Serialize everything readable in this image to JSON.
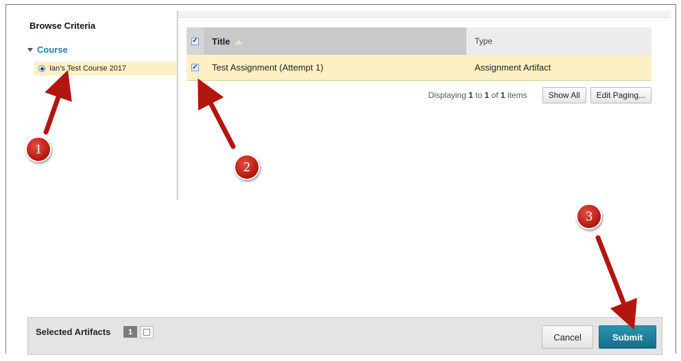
{
  "browse": {
    "title": "Browse Criteria",
    "course_label": "Course",
    "selected_course": "Ian's Test Course 2017"
  },
  "table": {
    "title_header": "Title",
    "type_header": "Type",
    "rows": [
      {
        "title": "Test Assignment (Attempt 1)",
        "type": "Assignment Artifact",
        "checked": true
      }
    ]
  },
  "paging": {
    "prefix": "Displaying",
    "from": "1",
    "to_word": "to",
    "to": "1",
    "of_word": "of",
    "total": "1",
    "suffix": "items",
    "show_all_label": "Show All",
    "edit_paging_label": "Edit Paging..."
  },
  "footer": {
    "selected_label": "Selected Artifacts",
    "selected_count": "1",
    "cancel_label": "Cancel",
    "submit_label": "Submit"
  },
  "annotations": {
    "step1": "1",
    "step2": "2",
    "step3": "3",
    "arrow_color": "#b3150f"
  },
  "colors": {
    "accent": "#1f7fa4",
    "highlight_row": "#fcf0c4",
    "submit": "#136f8c"
  }
}
